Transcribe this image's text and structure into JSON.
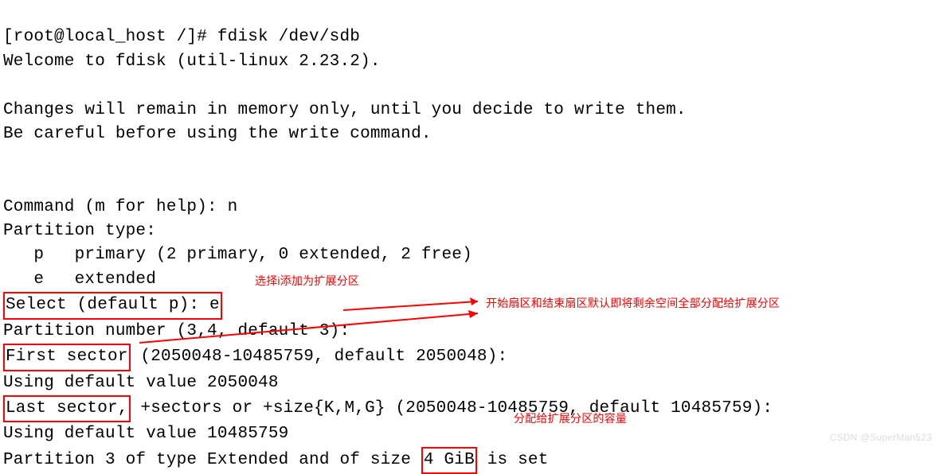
{
  "terminal": {
    "line1": "[root@local_host /]# fdisk /dev/sdb",
    "line2": "Welcome to fdisk (util-linux 2.23.2).",
    "line3": "",
    "line4": "Changes will remain in memory only, until you decide to write them.",
    "line5": "Be careful before using the write command.",
    "line6": "",
    "line7": "",
    "line8": "Command (m for help): n",
    "line9": "Partition type:",
    "line10": "   p   primary (2 primary, 0 extended, 2 free)",
    "line11": "   e   extended",
    "select_prefix": "Select (default p): e",
    "partno": "Partition number (3,4, default 3):",
    "first_sector_label": "First sector",
    "first_sector_rest": " (2050048-10485759, default 2050048):",
    "using_first": "Using default value 2050048",
    "last_sector_label": "Last sector,",
    "last_sector_rest": " +sectors or +size{K,M,G} (2050048-10485759, default 10485759):",
    "using_last": "Using default value 10485759",
    "result_prefix": "Partition 3 of type Extended and of size ",
    "result_size": "4 GiB",
    "result_suffix": " is set"
  },
  "annotations": {
    "select_note": "选择i添加为扩展分区",
    "sector_note": "开始扇区和结束扇区默认即将剩余空间全部分配给扩展分区",
    "size_note": "分配给扩展分区的容量"
  },
  "watermark": "CSDN @SuperMan523"
}
